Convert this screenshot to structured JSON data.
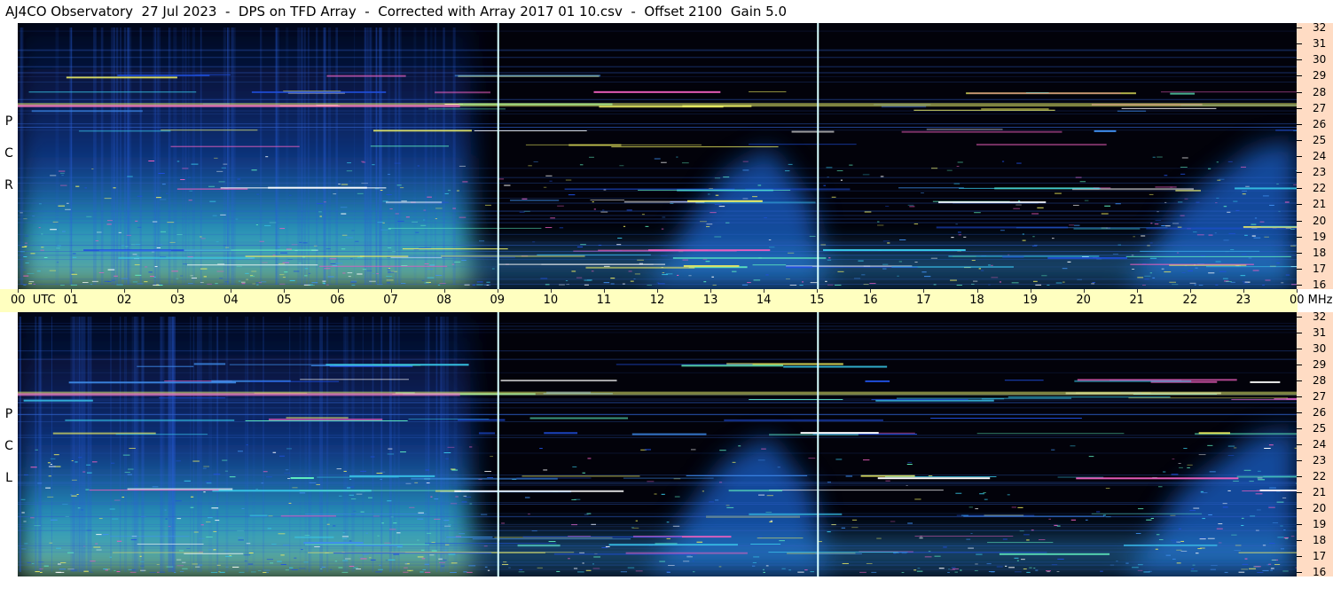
{
  "title": "AJ4CO Observatory  27 Jul 2023  -  DPS on TFD Array  -  Corrected with Array 2017 01 10.csv  -  Offset 2100  Gain 5.0",
  "colors": {
    "background": "#02020a",
    "utc_bar": "#ffffc0",
    "mhz_axis": "#ffdcc4",
    "marker_line": "#d8ffff"
  },
  "chart_data": {
    "type": "heatmap",
    "title": "AJ4CO Observatory  27 Jul 2023  -  DPS on TFD Array  -  Corrected with Array 2017 01 10.csv  -  Offset 2100  Gain 5.0",
    "x": {
      "unit": "UTC",
      "range": [
        0,
        24
      ],
      "tick_labels": [
        "00",
        "01",
        "02",
        "03",
        "04",
        "05",
        "06",
        "07",
        "08",
        "09",
        "10",
        "11",
        "12",
        "13",
        "14",
        "15",
        "16",
        "17",
        "18",
        "19",
        "20",
        "21",
        "22",
        "23",
        "00"
      ],
      "first_label_suffix": "UTC"
    },
    "y": {
      "unit": "MHz",
      "range": [
        16,
        32
      ],
      "tick_labels": [
        "32",
        "31",
        "30",
        "29",
        "28",
        "27",
        "26",
        "25",
        "24",
        "23",
        "22",
        "21",
        "20",
        "19",
        "18",
        "17",
        "16"
      ]
    },
    "panels": [
      {
        "label": [
          "R",
          "C",
          "P"
        ]
      },
      {
        "label": [
          "L",
          "C",
          "P"
        ]
      }
    ],
    "marker_lines_utc": [
      9,
      15
    ],
    "interference_bands_mhz": [
      17.2,
      17.8,
      18.2,
      19.6,
      21.2,
      22.0,
      24.7,
      25.6,
      26.9,
      27.2,
      28.0,
      29.0
    ]
  }
}
